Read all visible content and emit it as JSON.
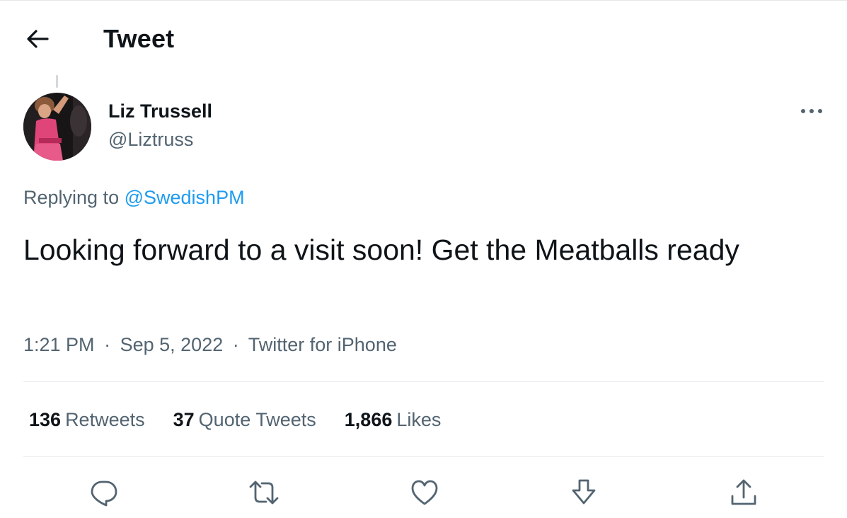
{
  "header": {
    "title": "Tweet",
    "back_icon": "arrow-left-icon"
  },
  "author": {
    "name": "Liz Trussell",
    "handle": "@Liztruss"
  },
  "reply": {
    "prefix": "Replying to",
    "to_handle": "@SwedishPM"
  },
  "tweet": {
    "text": "Looking forward to a visit soon! Get the Meatballs ready",
    "time": "1:21 PM",
    "date": "Sep 5, 2022",
    "source": "Twitter for iPhone",
    "separator": "·"
  },
  "stats": {
    "retweets": {
      "count": "136",
      "label": "Retweets"
    },
    "quotes": {
      "count": "37",
      "label": "Quote Tweets"
    },
    "likes": {
      "count": "1,866",
      "label": "Likes"
    }
  },
  "actions": [
    "reply-icon",
    "retweet-icon",
    "like-icon",
    "bookmark-icon",
    "share-icon"
  ],
  "colors": {
    "link": "#1d9bf0",
    "secondary_text": "#536471",
    "primary_text": "#0f1419",
    "divider": "#e6e9ec"
  }
}
